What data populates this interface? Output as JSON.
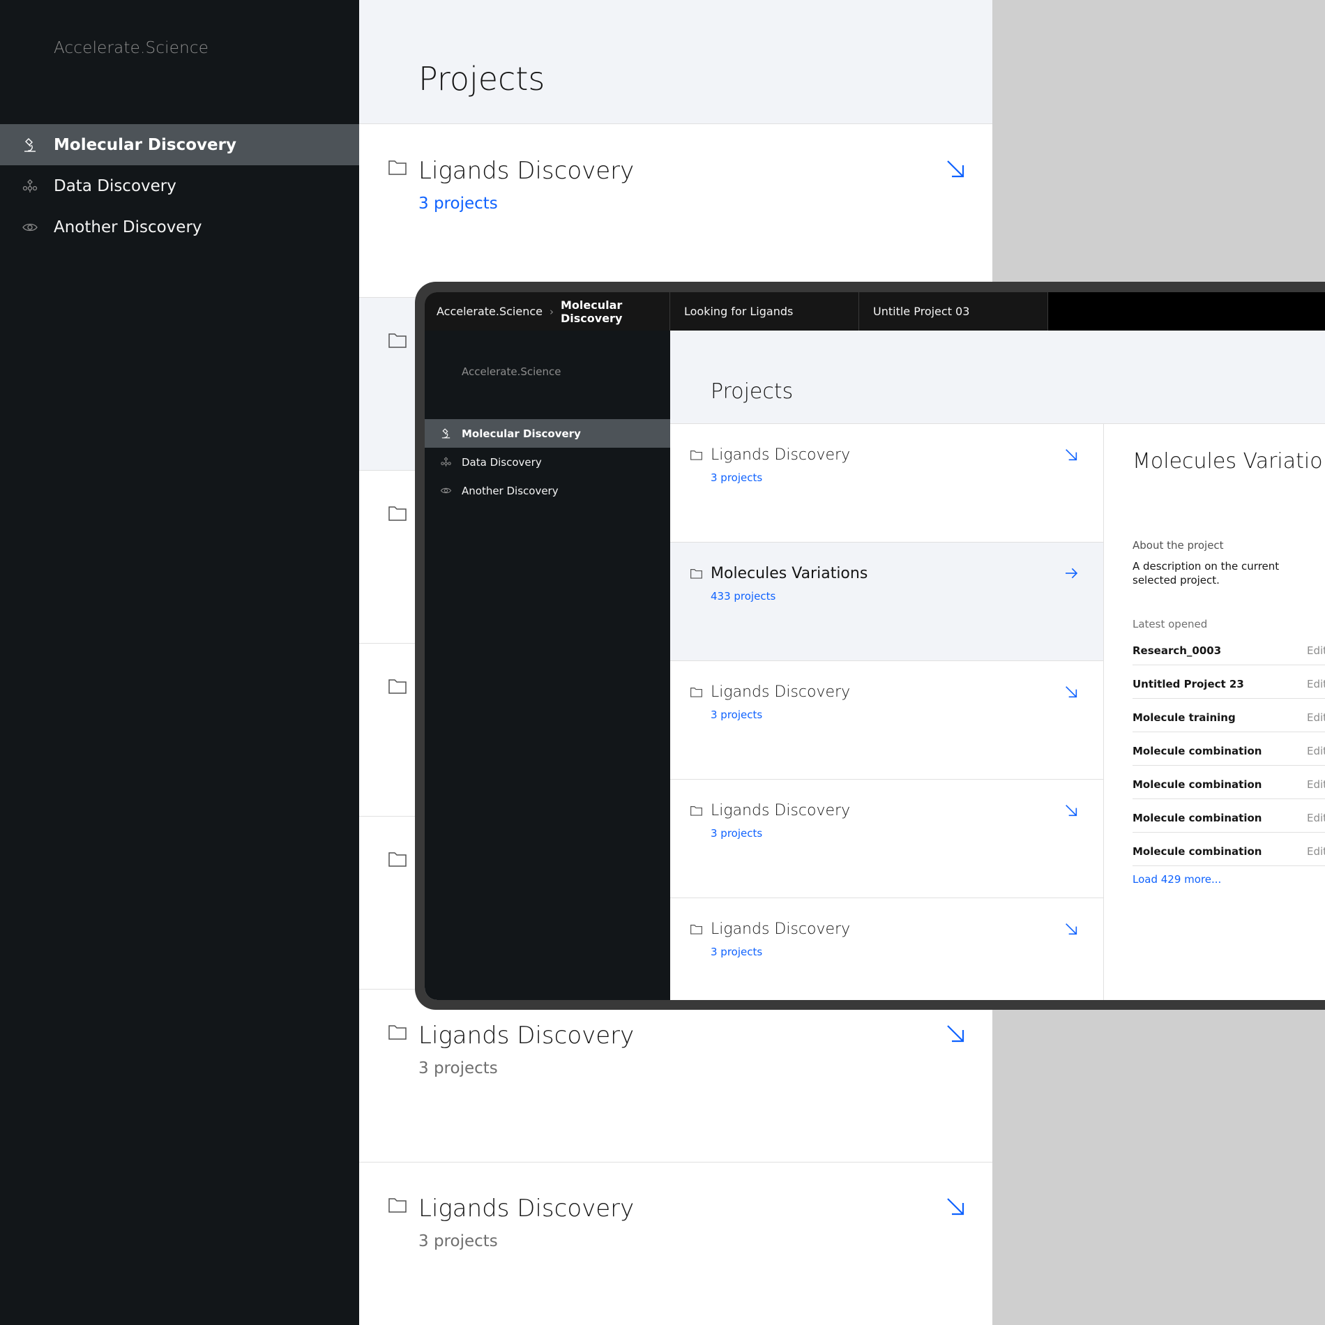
{
  "colors": {
    "accent": "#0f62fe",
    "sidebar": "#121619",
    "active_nav": "#4d5358",
    "header_bg": "#f2f4f8"
  },
  "background_app": {
    "brand": "Accelerate.Science",
    "nav": [
      {
        "label": "Molecular Discovery",
        "icon": "microscope-icon",
        "active": true
      },
      {
        "label": "Data Discovery",
        "icon": "network-icon",
        "active": false
      },
      {
        "label": "Another Discovery",
        "icon": "eye-icon",
        "active": false
      }
    ],
    "page_title": "Projects",
    "cards": [
      {
        "name": "Ligands Discovery",
        "count": "3 projects"
      },
      {
        "name": "",
        "count": ""
      },
      {
        "name": "",
        "count": ""
      },
      {
        "name": "",
        "count": ""
      },
      {
        "name": "",
        "count": ""
      },
      {
        "name": "Ligands Discovery",
        "count": "3 projects"
      },
      {
        "name": "Ligands Discovery",
        "count": "3 projects"
      }
    ]
  },
  "foreground_app": {
    "tabs": {
      "breadcrumb_root": "Accelerate.Science",
      "breadcrumb_current": "Molecular Discovery",
      "tab2": "Looking for Ligands",
      "tab3": "Untitle Project 03"
    },
    "brand": "Accelerate.Science",
    "nav": [
      {
        "label": "Molecular Discovery",
        "icon": "microscope-icon",
        "active": true
      },
      {
        "label": "Data Discovery",
        "icon": "network-icon",
        "active": false
      },
      {
        "label": "Another Discovery",
        "icon": "eye-icon",
        "active": false
      }
    ],
    "page_title": "Projects",
    "cards": [
      {
        "name": "Ligands Discovery",
        "count": "3 projects"
      },
      {
        "name": "Molecules Variations",
        "count": "433 projects"
      },
      {
        "name": "Ligands Discovery",
        "count": "3 projects"
      },
      {
        "name": "Ligands Discovery",
        "count": "3 projects"
      },
      {
        "name": "Ligands Discovery",
        "count": "3 projects"
      }
    ],
    "detail": {
      "title": "Molecules Variations",
      "about_label": "About the project",
      "description": "A description on the current selected project.",
      "latest_label": "Latest opened",
      "edit_label": "Edit",
      "rows": [
        "Research_0003",
        "Untitled Project 23",
        "Molecule training",
        "Molecule combination",
        "Molecule combination",
        "Molecule combination",
        "Molecule combination"
      ],
      "load_more": "Load 429 more..."
    }
  }
}
